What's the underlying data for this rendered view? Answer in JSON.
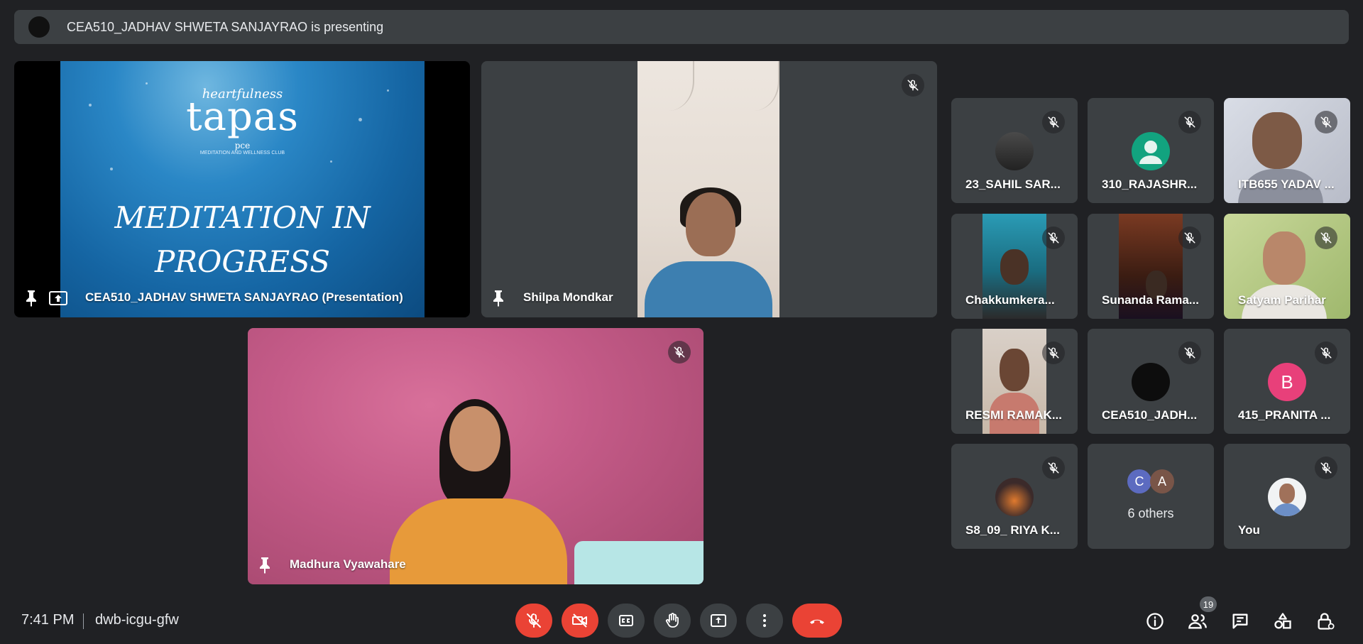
{
  "banner": {
    "text": "CEA510_JADHAV SHWETA SANJAYRAO is presenting"
  },
  "presentation": {
    "name": "CEA510_JADHAV SHWETA SANJAYRAO (Presentation)",
    "slide": {
      "brand_small": "heartfulness",
      "brand_big": "tapas",
      "brand_sub": "pce",
      "brand_tag": "MEDITATION AND WELLNESS CLUB",
      "heading_line1": "MEDITATION IN",
      "heading_line2": "PROGRESS"
    }
  },
  "featured": [
    {
      "name": "Shilpa Mondkar"
    },
    {
      "name": "Madhura Vyawahare"
    }
  ],
  "grid": [
    {
      "name": "23_SAHIL SAR..."
    },
    {
      "name": "310_RAJASHR..."
    },
    {
      "name": "ITB655 YADAV ..."
    },
    {
      "name": "Chakkumkera..."
    },
    {
      "name": "Sunanda Rama..."
    },
    {
      "name": "Satyam Parihar"
    },
    {
      "name": "RESMI RAMAK..."
    },
    {
      "name": "CEA510_JADH..."
    },
    {
      "name": "415_PRANITA ...",
      "initial": "B"
    },
    {
      "name": "S8_09_ RIYA K..."
    },
    {
      "name": "6 others",
      "initials": [
        "C",
        "A"
      ]
    },
    {
      "name": "You"
    }
  ],
  "bottom": {
    "time": "7:41 PM",
    "meeting_code": "dwb-icgu-gfw",
    "people_count": "19"
  },
  "icons": {
    "mic_off": "mic-off-icon",
    "cam_off": "videocam-off-icon",
    "captions": "closed-caption-icon",
    "hand": "raise-hand-icon",
    "present": "present-screen-icon",
    "more": "more-vert-icon",
    "hangup": "call-end-icon",
    "info": "info-icon",
    "people": "people-icon",
    "chat": "chat-icon",
    "activities": "activities-icon",
    "host": "host-controls-icon"
  },
  "colors": {
    "red": "#ea4335",
    "bg": "#202124",
    "tile": "#3c4043"
  }
}
